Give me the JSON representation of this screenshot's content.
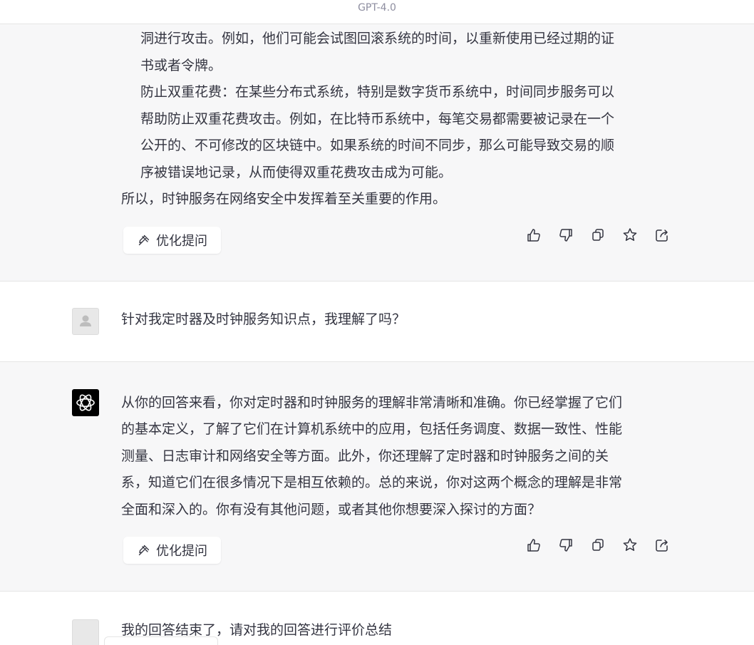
{
  "header": {
    "model": "GPT-4.0"
  },
  "prev_answer": {
    "lines": [
      "洞进行攻击。例如，他们可能会试图回滚系统的时间，以重新使用已经过期的证",
      "书或者令牌。",
      "防止双重花费：在某些分布式系统，特别是数字货币系统中，时间同步服务可以",
      "帮助防止双重花费攻击。例如，在比特币系统中，每笔交易都需要被记录在一个",
      "公开的、不可修改的区块链中。如果系统的时间不同步，那么可能导致交易的顺",
      "序被错误地记录，从而使得双重花费攻击成为可能。",
      "所以，时钟服务在网络安全中发挥着至关重要的作用。"
    ],
    "optimize_label": "优化提问"
  },
  "user_question": {
    "text": "针对我定时器及时钟服务知识点，我理解了吗？"
  },
  "ai_answer": {
    "lines": [
      "从你的回答来看，你对定时器和时钟服务的理解非常清晰和准确。你已经掌握了它们",
      "的基本定义，了解了它们在计算机系统中的应用，包括任务调度、数据一致性、性能",
      "测量、日志审计和网络安全等方面。此外，你还理解了定时器和时钟服务之间的关",
      "系，知道它们在很多情况下是相互依赖的。总的来说，你对这两个概念的理解是非常",
      "全面和深入的。你有没有其他问题，或者其他你想要深入探讨的方面？"
    ],
    "optimize_label": "优化提问"
  },
  "next_question": {
    "text": "我的回答结束了，请对我的回答进行评价总结"
  },
  "icons": {
    "like": "thumbs-up-icon",
    "dislike": "thumbs-down-icon",
    "copy": "copy-icon",
    "favorite": "star-icon",
    "share": "share-icon",
    "optimize": "sparkle-pin-icon",
    "assistant": "openai-logo-icon",
    "user": "user-avatar-icon"
  },
  "colors": {
    "ai_background": "#f7f7f8",
    "text": "#343541",
    "icon": "#343541"
  }
}
